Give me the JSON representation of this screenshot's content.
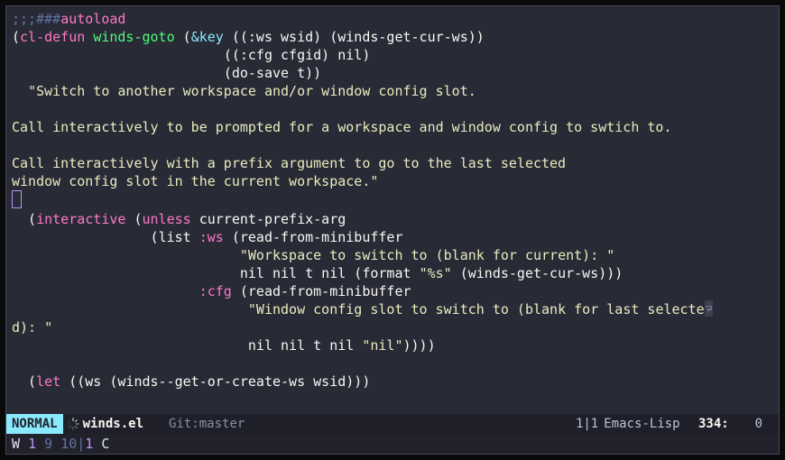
{
  "code": {
    "l1_comment": ";;;###",
    "l1_auto": "autoload",
    "kw_cldefun": "cl-defun",
    "fn_name": "winds-goto",
    "kw_key": "&key",
    "arg_ws": "((:ws wsid) (winds-get-cur-ws))",
    "arg_cfg": "((:cfg cfgid) nil)",
    "arg_dosave": "(do-save t))",
    "doc1": "\"Switch to another workspace and/or window config slot.",
    "doc2": "Call interactively to be prompted for a workspace and window config to swtich to.",
    "doc3": "Call interactively with a prefix argument to go to the last selected",
    "doc4": "window config slot in the current workspace.\"",
    "kw_interactive": "interactive",
    "kw_unless": "unless",
    "sym_cpa": "current-prefix-arg",
    "sym_list": "list",
    "kw_ws": ":ws",
    "call_rfm1": "(read-from-minibuffer",
    "str_ws": "\"Workspace to switch to (blank for current): \"",
    "args_rfm1": "nil nil t nil (format ",
    "str_fmt": "\"%s\"",
    "call_curws": " (winds-get-cur-ws)))",
    "kw_cfg": ":cfg",
    "call_rfm2": "(read-from-minibuffer",
    "str_cfg": "\"Window config slot to switch to (blank for last selecte",
    "wrap_d": "d): \"",
    "args_rfm2": "nil nil t nil ",
    "str_nil": "\"nil\"",
    "close1": "))))",
    "kw_let": "let",
    "let_body": " ((ws (winds--get-or-create-ws wsid)))"
  },
  "modeline": {
    "state": "NORMAL",
    "file": "winds.el",
    "vcs": "Git:master",
    "persp": "1|1",
    "mode": "Emacs-Lisp",
    "line": "334:",
    "col": "0"
  },
  "hint": {
    "W": "W",
    "w1": "1",
    "w9": "9",
    "w10": "10",
    "sep": " | ",
    "C": "C",
    "c1": "1"
  }
}
